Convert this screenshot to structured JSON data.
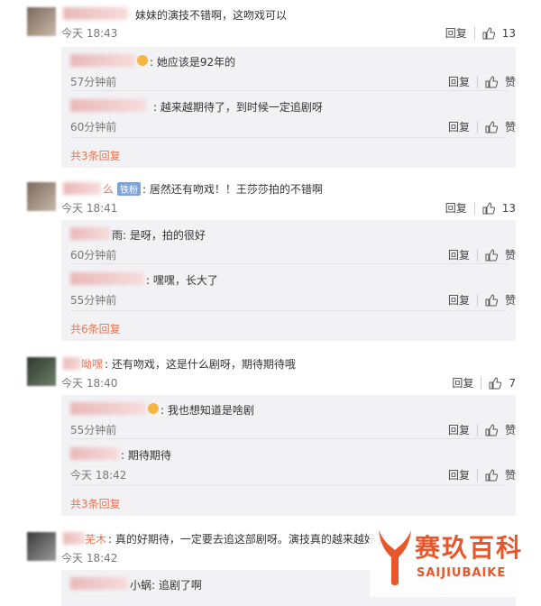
{
  "labels": {
    "reply": "回复",
    "like": "赞"
  },
  "comments": [
    {
      "text": "妹妹的演技不错啊，这吻戏可以",
      "time": "今天 18:43",
      "likes": "13",
      "replies": [
        {
          "text": ": 她应该是92年的",
          "time": "57分钟前"
        },
        {
          "text": ": 越来越期待了，到时候一定追剧呀",
          "time": "60分钟前"
        }
      ],
      "more": "共3条回复"
    },
    {
      "name_suffix": "么",
      "badge": "铁粉",
      "text": ": 居然还有吻戏！！王莎莎拍的不错啊",
      "time": "今天 18:41",
      "likes": "13",
      "replies": [
        {
          "text": "雨: 是呀，拍的很好",
          "time": "60分钟前"
        },
        {
          "text": ": 嘿嘿，长大了",
          "time": "55分钟前"
        }
      ],
      "more": "共6条回复"
    },
    {
      "name_suffix": "呦嘿",
      "text": ": 还有吻戏，这是什么剧呀，期待期待哦",
      "time": "今天 18:40",
      "likes": "7",
      "replies": [
        {
          "text": ": 我也想知道是啥剧",
          "time": "55分钟前"
        },
        {
          "text": ": 期待期待",
          "time": "今天 18:42"
        }
      ],
      "more": "共3条回复"
    },
    {
      "name_suffix": "芜木",
      "text": ": 真的好期待，一定要去追这部剧呀。演技真的越来越好了",
      "time": "今天 18:42",
      "replies": [
        {
          "text": "小蜗: 追剧了啊"
        }
      ]
    }
  ],
  "watermark": {
    "title": "赛玖百科",
    "subtitle": "SAIJIUBAIKE"
  }
}
